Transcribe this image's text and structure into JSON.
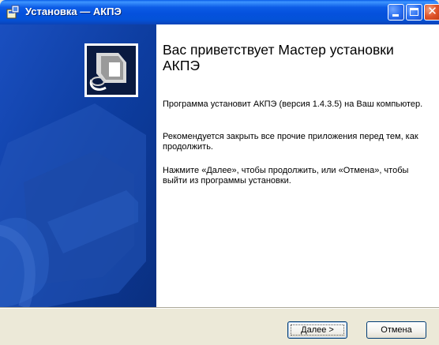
{
  "window": {
    "title": "Установка — АКПЭ",
    "icon": "installer-icon",
    "buttons": {
      "minimize_icon": "minimize-icon",
      "maximize_icon": "maximize-icon",
      "close_icon": "close-icon",
      "close_glyph": "✕"
    }
  },
  "sidebar": {
    "image": "setup-wizard-image",
    "colors": {
      "background": "#0e3ea2",
      "shape": "#2557b8"
    }
  },
  "content": {
    "heading": "Вас приветствует Мастер установки АКПЭ",
    "paragraphs": [
      "Программа установит АКПЭ (версия 1.4.3.5) на Ваш компьютер.",
      "Рекомендуется закрыть все прочие приложения перед тем, как продолжить.",
      "Нажмите «Далее», чтобы продолжить, или «Отмена», чтобы выйти из программы установки."
    ]
  },
  "footer": {
    "next_label": "Далее >",
    "cancel_label": "Отмена"
  }
}
